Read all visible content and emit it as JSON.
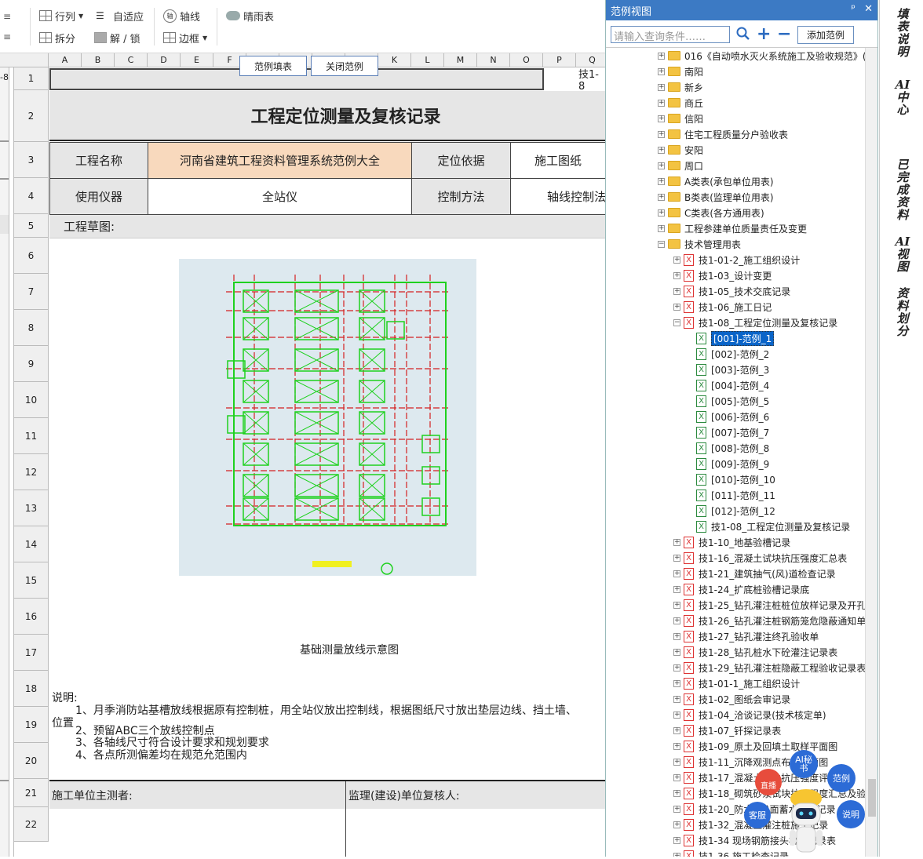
{
  "toolbar": {
    "row_col": "行列",
    "autofit": "自适应",
    "axis": "轴线",
    "weather": "晴雨表",
    "split": "拆分",
    "unlock": "解 / 锁",
    "border": "边框"
  },
  "popup_buttons": {
    "fill": "范例填表",
    "close": "关闭范例"
  },
  "columns": [
    "A",
    "B",
    "C",
    "D",
    "E",
    "F",
    "",
    "",
    "",
    "",
    "K",
    "L",
    "M",
    "N",
    "O",
    "P",
    "Q"
  ],
  "rows": [
    "1",
    "2",
    "3",
    "4",
    "5",
    "6",
    "7",
    "8",
    "9",
    "10",
    "11",
    "12",
    "13",
    "14",
    "15",
    "16",
    "17",
    "18",
    "19",
    "20",
    "21",
    "22"
  ],
  "stub_text": "-8",
  "form": {
    "header_code": "技1-8",
    "title": "工程定位测量及复核记录",
    "project_name_label": "工程名称",
    "project_name_value": "河南省建筑工程资料管理系统范例大全",
    "basis_label": "定位依据",
    "basis_value": "施工图纸",
    "instrument_label": "使用仪器",
    "instrument_value": "全站仪",
    "control_label": "控制方法",
    "control_value": "轴线控制法",
    "sketch_label": "工程草图:",
    "caption": "基础测量放线示意图",
    "notes_label": "说明:",
    "note1": "1、月季消防站基槽放线根据原有控制桩，用全站仪放出控制线，根据图纸尺寸放出垫层边线、挡土墙、",
    "note1b": "位置",
    "note2": "2、预留ABC三个放线控制点",
    "note3": "3、各轴线尺寸符合设计要求和规划要求",
    "note4": "4、各点所测偏差均在规范允范围内",
    "surveyor_label": "施工单位主测者:",
    "reviewer_label": "监理(建设)单位复核人:"
  },
  "panel": {
    "title": "范例视图",
    "pin": "ᵖ",
    "close": "✕",
    "search_placeholder": "请输入查询条件……",
    "add_button": "添加范例",
    "tree": [
      {
        "label": "016《自动喷水灭火系统施工及验收规范》(",
        "type": "folder",
        "indent": 0
      },
      {
        "label": "南阳",
        "type": "folder",
        "indent": 0
      },
      {
        "label": "新乡",
        "type": "folder",
        "indent": 0
      },
      {
        "label": "商丘",
        "type": "folder",
        "indent": 0
      },
      {
        "label": "信阳",
        "type": "folder",
        "indent": 0
      },
      {
        "label": "住宅工程质量分户验收表",
        "type": "folder",
        "indent": 0
      },
      {
        "label": "安阳",
        "type": "folder",
        "indent": 0
      },
      {
        "label": "周口",
        "type": "folder",
        "indent": 0
      },
      {
        "label": "A类表(承包单位用表)",
        "type": "folder",
        "indent": 0
      },
      {
        "label": "B类表(监理单位用表)",
        "type": "folder",
        "indent": 0
      },
      {
        "label": "C类表(各方通用表)",
        "type": "folder",
        "indent": 0
      },
      {
        "label": "工程参建单位质量责任及变更",
        "type": "folder",
        "indent": 0
      },
      {
        "label": "技术管理用表",
        "type": "folder-open",
        "indent": 0
      },
      {
        "label": "技1-01-2_施工组织设计",
        "type": "red",
        "indent": 1
      },
      {
        "label": "技1-03_设计变更",
        "type": "red",
        "indent": 1
      },
      {
        "label": "技1-05_技术交底记录",
        "type": "red",
        "indent": 1
      },
      {
        "label": "技1-06_施工日记",
        "type": "red",
        "indent": 1
      },
      {
        "label": "技1-08_工程定位测量及复核记录",
        "type": "red-open",
        "indent": 1
      },
      {
        "label": "[001]-范例_1",
        "type": "green",
        "indent": 2,
        "selected": true
      },
      {
        "label": "[002]-范例_2",
        "type": "green",
        "indent": 2
      },
      {
        "label": "[003]-范例_3",
        "type": "green",
        "indent": 2
      },
      {
        "label": "[004]-范例_4",
        "type": "green",
        "indent": 2
      },
      {
        "label": "[005]-范例_5",
        "type": "green",
        "indent": 2
      },
      {
        "label": "[006]-范例_6",
        "type": "green",
        "indent": 2
      },
      {
        "label": "[007]-范例_7",
        "type": "green",
        "indent": 2
      },
      {
        "label": "[008]-范例_8",
        "type": "green",
        "indent": 2
      },
      {
        "label": "[009]-范例_9",
        "type": "green",
        "indent": 2
      },
      {
        "label": "[010]-范例_10",
        "type": "green",
        "indent": 2
      },
      {
        "label": "[011]-范例_11",
        "type": "green",
        "indent": 2
      },
      {
        "label": "[012]-范例_12",
        "type": "green",
        "indent": 2
      },
      {
        "label": "技1-08_工程定位测量及复核记录",
        "type": "green",
        "indent": 2
      },
      {
        "label": "技1-10_地基验槽记录",
        "type": "red",
        "indent": 1
      },
      {
        "label": "技1-16_混凝土试块抗压强度汇总表",
        "type": "red",
        "indent": 1
      },
      {
        "label": "技1-21_建筑抽气(风)道检查记录",
        "type": "red",
        "indent": 1
      },
      {
        "label": "技1-24_扩底桩验槽记录底",
        "type": "red",
        "indent": 1
      },
      {
        "label": "技1-25_钻孔灌注桩桩位放样记录及开孔",
        "type": "red",
        "indent": 1
      },
      {
        "label": "技1-26_钻孔灌注桩钢筋笼危隐蔽通知单",
        "type": "red",
        "indent": 1
      },
      {
        "label": "技1-27_钻孔灌注终孔验收单",
        "type": "red",
        "indent": 1
      },
      {
        "label": "技1-28_钻孔桩水下砼灌注记录表",
        "type": "red",
        "indent": 1
      },
      {
        "label": "技1-29_钻孔灌注桩隐蔽工程验收记录表",
        "type": "red",
        "indent": 1
      },
      {
        "label": "技1-01-1_施工组织设计",
        "type": "red",
        "indent": 1
      },
      {
        "label": "技1-02_图纸会审记录",
        "type": "red",
        "indent": 1
      },
      {
        "label": "技1-04_洽谈记录(技术核定单)",
        "type": "red",
        "indent": 1
      },
      {
        "label": "技1-07_钎探记录表",
        "type": "red",
        "indent": 1
      },
      {
        "label": "技1-09_原土及回填土取样平面图",
        "type": "red",
        "indent": 1
      },
      {
        "label": "技1-11_沉降观测点布置平面图",
        "type": "red",
        "indent": 1
      },
      {
        "label": "技1-17_混凝土试块抗压强度评定表",
        "type": "red",
        "indent": 1
      },
      {
        "label": "技1-18_砌筑砂浆试块抗压强度汇总及验",
        "type": "red",
        "indent": 1
      },
      {
        "label": "技1-20_防水(地)面蓄水检验记录",
        "type": "red",
        "indent": 1
      },
      {
        "label": "技1-32_混凝土灌注桩施工记录",
        "type": "red",
        "indent": 1
      },
      {
        "label": "技1-34 现场钢筋接头检验记录表",
        "type": "red",
        "indent": 1
      },
      {
        "label": "技1-36 施工检查记录",
        "type": "red",
        "indent": 1
      }
    ]
  },
  "right_tabs": [
    "填表说明",
    "AI中心",
    "已完成资料",
    "AI视图",
    "资料划分"
  ],
  "float_buttons": {
    "ai": "AI秘书",
    "example": "范例",
    "live": "直播",
    "service": "客服",
    "explain": "说明"
  },
  "colors": {
    "accent": "#3c7ac4",
    "peach": "#f8d9bd",
    "grey": "#e6e6e6",
    "drawing_bg": "#dde9ef",
    "green_line": "#1fd11f",
    "red_line": "#d42020"
  }
}
